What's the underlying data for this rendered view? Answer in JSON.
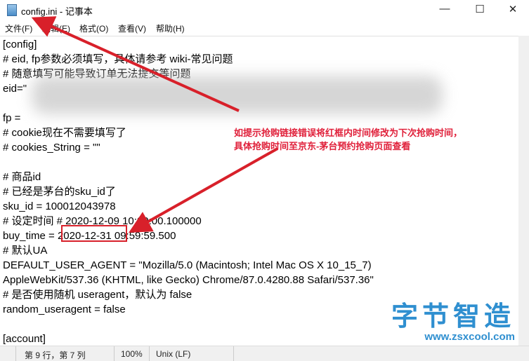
{
  "window": {
    "title": "config.ini - 记事本",
    "minimize": "—",
    "maximize": "☐",
    "close": "✕"
  },
  "menu": [
    "文件(F)",
    "编辑(E)",
    "格式(O)",
    "查看(V)",
    "帮助(H)"
  ],
  "lines": [
    "[config]",
    "# eid, fp参数必须填写，具体请参考 wiki-常见问题",
    "# 随意填写可能导致订单无法提交等问题",
    "eid=\"",
    "",
    "fp = ",
    "# cookie现在不需要填写了",
    "# cookies_String = \"\"",
    "",
    "# 商品id",
    "# 已经是茅台的sku_id了",
    "sku_id = 100012043978",
    "# 设定时间 # 2020-12-09 10:00:00.100000",
    "buy_time = 2020-12-31 09:59:59.500",
    "# 默认UA",
    "DEFAULT_USER_AGENT = \"Mozilla/5.0 (Macintosh; Intel Mac OS X 10_15_7)",
    "AppleWebKit/537.36 (KHTML, like Gecko) Chrome/87.0.4280.88 Safari/537.36\"",
    "# 是否使用随机 useragent，默认为 false",
    "random_useragent = false",
    "",
    "[account]"
  ],
  "annotation": {
    "line1": "如提示抢购链接错误将红框内时间修改为下次抢购时间，",
    "line2": "具体抢购时间至京东-茅台预约抢购页面查看"
  },
  "status": {
    "position": "第 9 行，第 7 列",
    "zoom": "100%",
    "encoding": "Unix (LF)"
  },
  "watermark": {
    "name": "字节智造",
    "url": "www.zsxcool.com"
  },
  "colors": {
    "annotation": "#e0203a",
    "watermark": "#2f8fd0"
  }
}
